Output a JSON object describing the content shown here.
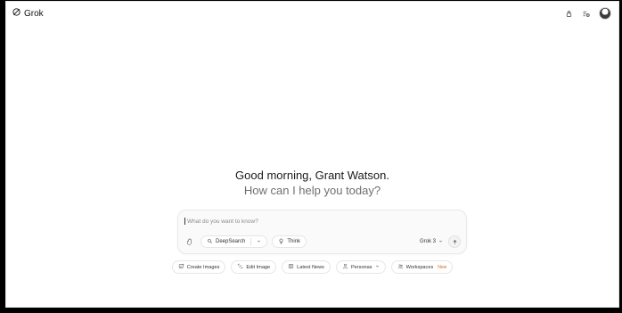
{
  "brand": {
    "name": "Grok"
  },
  "greeting": {
    "line1": "Good morning, Grant Watson.",
    "line2": "How can I help you today?"
  },
  "prompt": {
    "placeholder": "What do you want to know?",
    "value": ""
  },
  "controls": {
    "deepsearch_label": "DeepSearch",
    "think_label": "Think",
    "model_label": "Grok 3"
  },
  "quick_actions": {
    "create_images": "Create Images",
    "edit_image": "Edit Image",
    "latest_news": "Latest News",
    "personas": "Personas",
    "workspaces": "Workspaces",
    "workspaces_badge": "New"
  },
  "icons": {
    "brand": "grok-logo-icon",
    "top_1": "lock-icon",
    "top_2": "history-icon",
    "attach": "paperclip-icon",
    "deepsearch": "deepsearch-icon",
    "think": "lightbulb-icon",
    "send": "arrow-up-icon"
  },
  "colors": {
    "badge": "#d06a2d",
    "text": "#1a1a1a",
    "muted": "#6f6f6f",
    "border": "#e6e6e6"
  }
}
